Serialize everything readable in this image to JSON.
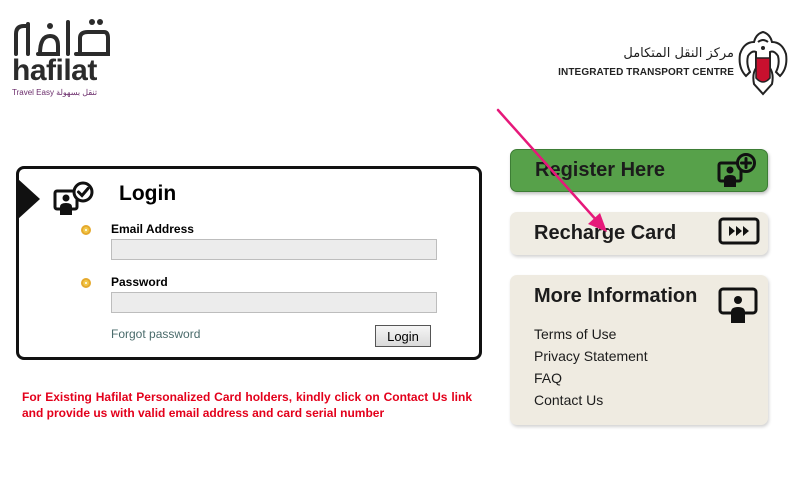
{
  "header": {
    "brand_arabic": "حافلات",
    "brand_name": "hafilat",
    "tagline": "Travel Easy  تنقل بسهولة",
    "org_arabic": "مركز النقل المتكامل",
    "org_english": "INTEGRATED TRANSPORT CENTRE"
  },
  "login": {
    "title": "Login",
    "email_label": "Email Address",
    "email_value": "",
    "password_label": "Password",
    "password_value": "",
    "forgot_link": "Forgot password",
    "submit_label": "Login"
  },
  "notice": "For Existing Hafilat Personalized Card holders, kindly click on Contact Us link and provide us with valid email address and card serial number",
  "panels": {
    "register_label": "Register Here",
    "recharge_label": "Recharge Card",
    "info_title": "More Information",
    "info_links": [
      "Terms of Use",
      "Privacy Statement",
      "FAQ",
      "Contact Us"
    ]
  },
  "colors": {
    "register_green": "#57a14a",
    "notice_red": "#e3001b",
    "panel_beige": "#efebe1",
    "brand_purple": "#6b2c6b",
    "annotation_arrow": "#e6197a"
  },
  "icons": {
    "login": "user-check-icon",
    "register": "user-add-icon",
    "recharge": "card-forward-icon",
    "info": "user-screen-icon",
    "emblem": "falcon-emblem-icon"
  }
}
